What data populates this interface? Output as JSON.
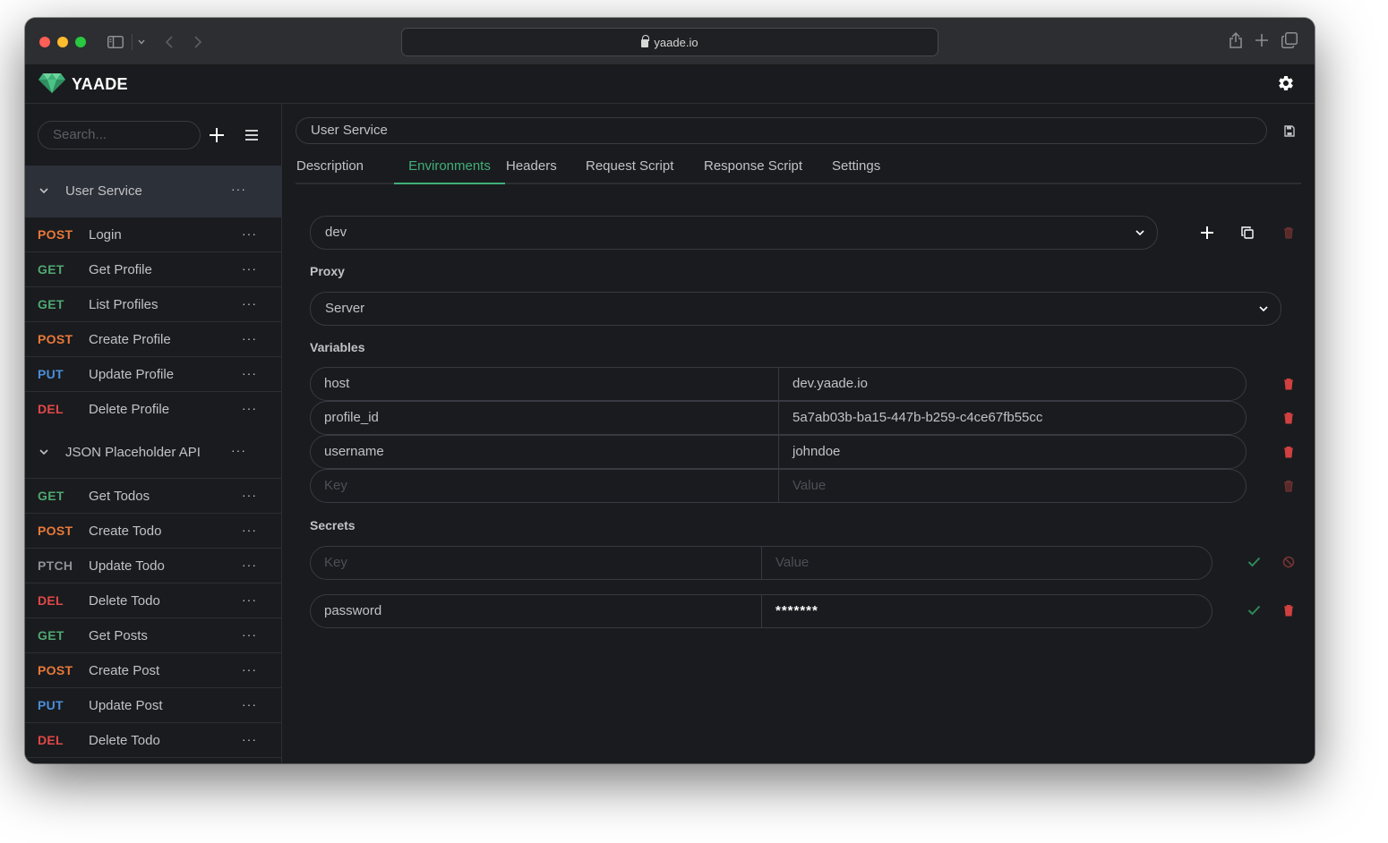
{
  "browser": {
    "url": "yaade.io"
  },
  "app": {
    "brand": "YAADE",
    "colors": {
      "accent": "#3fb07a",
      "post": "#e8793a",
      "get": "#4fa872",
      "put": "#4a8fd9",
      "del": "#e04848",
      "patch": "#8e9096",
      "danger": "#c23838"
    }
  },
  "sidebar": {
    "search_placeholder": "Search...",
    "collections": [
      {
        "name": "User Service",
        "requests": [
          {
            "method": "POST",
            "name": "Login"
          },
          {
            "method": "GET",
            "name": "Get Profile"
          },
          {
            "method": "GET",
            "name": "List Profiles"
          },
          {
            "method": "POST",
            "name": "Create Profile"
          },
          {
            "method": "PUT",
            "name": "Update Profile"
          },
          {
            "method": "DEL",
            "name": "Delete Profile"
          }
        ]
      },
      {
        "name": "JSON Placeholder API",
        "requests": [
          {
            "method": "GET",
            "name": "Get Todos"
          },
          {
            "method": "POST",
            "name": "Create Todo"
          },
          {
            "method": "PTCH",
            "name": "Update Todo"
          },
          {
            "method": "DEL",
            "name": "Delete Todo"
          },
          {
            "method": "GET",
            "name": "Get Posts"
          },
          {
            "method": "POST",
            "name": "Create Post"
          },
          {
            "method": "PUT",
            "name": "Update Post"
          },
          {
            "method": "DEL",
            "name": "Delete Todo"
          }
        ]
      }
    ],
    "more_label": "···"
  },
  "main": {
    "title": "User Service",
    "tabs": [
      "Description",
      "Environments",
      "Headers",
      "Request Script",
      "Response Script",
      "Settings"
    ],
    "active_tab": "Environments",
    "environment": "dev",
    "proxy_label": "Proxy",
    "proxy_value": "Server",
    "variables_label": "Variables",
    "variables": [
      {
        "key": "host",
        "value": "dev.yaade.io"
      },
      {
        "key": "profile_id",
        "value": "5a7ab03b-ba15-447b-b259-c4ce67fb55cc"
      },
      {
        "key": "username",
        "value": "johndoe"
      }
    ],
    "key_placeholder": "Key",
    "value_placeholder": "Value",
    "secrets_label": "Secrets",
    "secrets": [
      {
        "key": "password",
        "value": "*******"
      }
    ]
  }
}
